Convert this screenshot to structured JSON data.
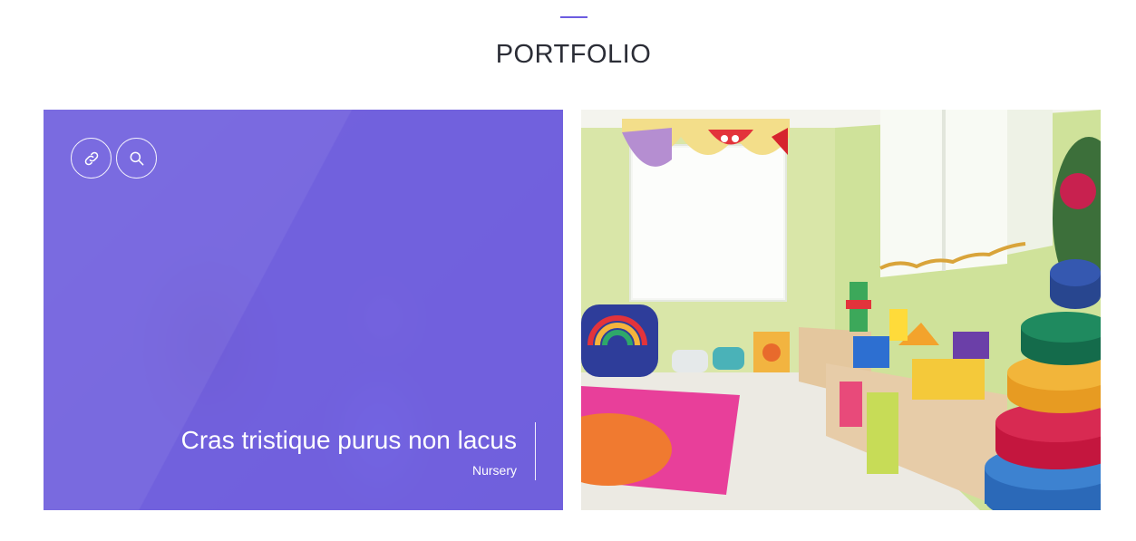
{
  "section": {
    "title": "PORTFOLIO",
    "accent_color": "#6c5ce0"
  },
  "portfolio_items": [
    {
      "title": "Cras tristique purus non lacus",
      "category": "Nursery",
      "overlay_color": "#6858e0",
      "icons": [
        "link-icon",
        "search-icon"
      ]
    },
    {
      "image": "colorful-playroom-photo"
    }
  ]
}
